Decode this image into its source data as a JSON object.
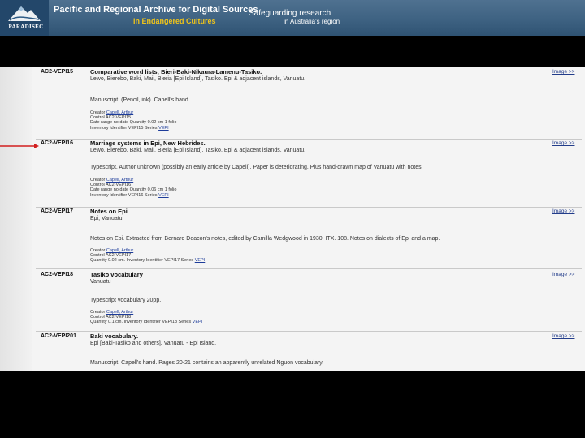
{
  "header": {
    "logo_text": "PARADISEC",
    "title_line1": "Pacific and Regional Archive for Digital Sources",
    "title_line2": "in Endangered Cultures",
    "tagline_line1": "Safeguarding research",
    "tagline_line2": "in Australia's region"
  },
  "records": [
    {
      "id": "AC2-VEPI15",
      "title": "Comparative word lists; Bieri-Baki-Nikaura-Lamenu-Tasiko.",
      "location": "Lewo, Bierebo, Baki, Maii, Bieria [Epi Island], Tasiko. Epi & adjacent islands, Vanuatu.",
      "description": "Manuscript. (Pencil, ink). Capell's hand.",
      "image_link": "Image >>",
      "meta": [
        {
          "label": "Creator",
          "value": "Capell, Arthur",
          "link": true
        },
        {
          "label": "Control",
          "value": "AC2-VEPI15",
          "link": false
        },
        {
          "label": "Date range no date",
          "value": "Quantity 0.02 cm 1 folio",
          "link": false
        },
        {
          "label": "Inventory Identifier VEPI15 Series",
          "value": "VEPI",
          "link": true
        }
      ]
    },
    {
      "id": "AC2-VEPI16",
      "title": "Marriage systems in Epi, New Hebrides.",
      "location": "Lewo, Bierebo, Baki, Maii, Bieria [Epi Island], Tasiko. Epi & adjacent islands, Vanuatu.",
      "description": "Typescript. Author unknown (possibly an early article by Capell). Paper is deteriorating. Plus hand-drawn map of Vanuatu with notes.",
      "image_link": "Image >>",
      "meta": [
        {
          "label": "Creator",
          "value": "Capell, Arthur",
          "link": true
        },
        {
          "label": "Control",
          "value": "AC2-VEPI16",
          "link": false
        },
        {
          "label": "Date range no date",
          "value": "Quantity 0.06 cm 1 folio",
          "link": false
        },
        {
          "label": "Inventory Identifier VEPI16 Series",
          "value": "VEPI",
          "link": true
        }
      ]
    },
    {
      "id": "AC2-VEPI17",
      "title": "Notes on Epi",
      "location": "Epi, Vanuatu",
      "description": "Notes on Epi. Extracted from Bernard Deacon's notes, edited by Camilla Wedgwood in 1930, ITX. 108. Notes on dialects of Epi and a map.",
      "image_link": "Image >>",
      "meta": [
        {
          "label": "Creator",
          "value": "Capell, Arthur",
          "link": true
        },
        {
          "label": "Control",
          "value": "AC2-VEPI17",
          "link": false
        },
        {
          "label": "Quantity 0.02 cm. Inventory Identifier VEPI17 Series",
          "value": "VEPI",
          "link": true
        }
      ]
    },
    {
      "id": "AC2-VEPI18",
      "title": "Tasiko vocabulary",
      "location": "Vanuatu",
      "description": "Typescript vocabulary 20pp.",
      "image_link": "Image >>",
      "meta": [
        {
          "label": "Creator",
          "value": "Capell, Arthur",
          "link": true
        },
        {
          "label": "Control",
          "value": "AC2-VEPI18",
          "link": false
        },
        {
          "label": "Quantity 0.1 cm. Inventory Identifier VEPI18 Series",
          "value": "VEPI",
          "link": true
        }
      ]
    },
    {
      "id": "AC2-VEPI201",
      "title": "Baki vocabulary.",
      "location": "Epi [Baki-Tasiko and others]. Vanuatu - Epi Island.",
      "description": "Manuscript. Capell's hand. Pages 20-21 contains an apparently unrelated Nguon vocabulary.",
      "image_link": "Image >>",
      "meta": []
    }
  ],
  "colors": {
    "banner": "#3e6282",
    "accent": "#f0c419",
    "arrow": "#d21f1f",
    "link": "#1d3c9a"
  }
}
